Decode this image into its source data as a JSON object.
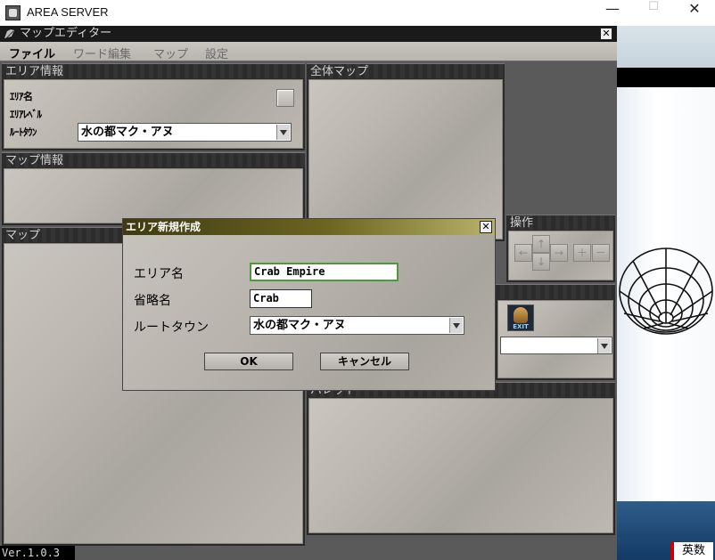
{
  "os_window": {
    "title": "AREA SERVER",
    "minimize": "—",
    "maximize": "☐",
    "close": "✕"
  },
  "editor": {
    "title": "マップエディター",
    "close": "✕",
    "menu": [
      "ファイル",
      "ワード編集",
      "マップ",
      "設定"
    ]
  },
  "area_info": {
    "heading": "エリア情報",
    "label_name": "ｴﾘｱ名",
    "label_level": "ｴﾘｱﾚﾍﾞﾙ",
    "label_town": "ﾙｰﾄﾀｳﾝ",
    "town_value": "水の都マク・アヌ"
  },
  "map_info": {
    "heading": "マップ情報"
  },
  "map_panel": {
    "heading": "マップ"
  },
  "overview_map": {
    "heading": "全体マップ"
  },
  "operation": {
    "heading": "操作",
    "up": "↑",
    "down": "↓",
    "left": "←",
    "right": "→",
    "plus": "＋",
    "minus": "－"
  },
  "palette": {
    "heading": "パレット"
  },
  "exit_icon": {
    "label": "EXIT"
  },
  "status": {
    "version": "Ver.1.0.3",
    "ime": "英数"
  },
  "dialog": {
    "title": "エリア新規作成",
    "close": "✕",
    "area_name_label": "エリア名",
    "area_name_value": "Crab Empire",
    "abbr_label": "省略名",
    "abbr_value": "Crab",
    "town_label": "ルートタウン",
    "town_value": "水の都マク・アヌ",
    "ok": "OK",
    "cancel": "キャンセル"
  }
}
